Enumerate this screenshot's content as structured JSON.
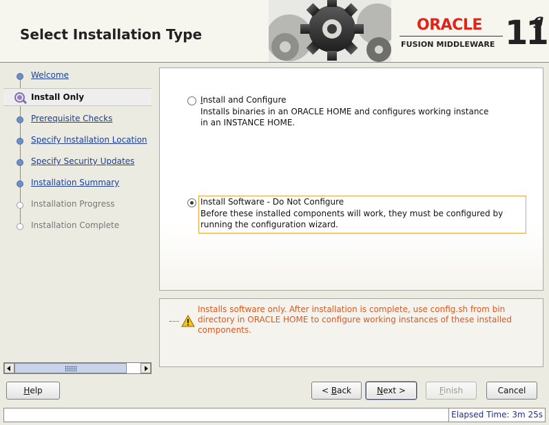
{
  "header": {
    "title": "Select Installation Type",
    "brand": "ORACLE",
    "product": "FUSION MIDDLEWARE",
    "version_number": "11",
    "version_letter": "g"
  },
  "nav": {
    "items": [
      {
        "label": "Welcome",
        "state": "link"
      },
      {
        "label": "Install Only",
        "state": "current"
      },
      {
        "label": "Prerequisite Checks",
        "state": "link"
      },
      {
        "label": "Specify Installation Location",
        "state": "link"
      },
      {
        "label": "Specify Security Updates",
        "state": "link"
      },
      {
        "label": "Installation Summary",
        "state": "link"
      },
      {
        "label": "Installation Progress",
        "state": "disabled"
      },
      {
        "label": "Installation Complete",
        "state": "disabled"
      }
    ]
  },
  "options": [
    {
      "title": "Install and Configure",
      "mnemonic": "I",
      "description": "Installs binaries in an ORACLE HOME and configures working instance in an INSTANCE HOME.",
      "selected": false
    },
    {
      "title": "Install Software - Do Not Configure",
      "mnemonic": "o",
      "description": "Before these installed components will work, they must be configured by running the configuration wizard.",
      "selected": true
    }
  ],
  "info": {
    "text": "Installs software only. After installation is complete, use config.sh from bin directory in ORACLE HOME to configure working instances of these installed components."
  },
  "buttons": {
    "help": "Help",
    "back": "< Back",
    "next": "Next >",
    "finish": "Finish",
    "cancel": "Cancel"
  },
  "status": {
    "elapsed": "Elapsed Time: 3m 25s"
  },
  "colors": {
    "link": "#1c3f94",
    "warning_text": "#e0571c",
    "focus": "#f1a23c",
    "brand_red": "#e2231a"
  }
}
